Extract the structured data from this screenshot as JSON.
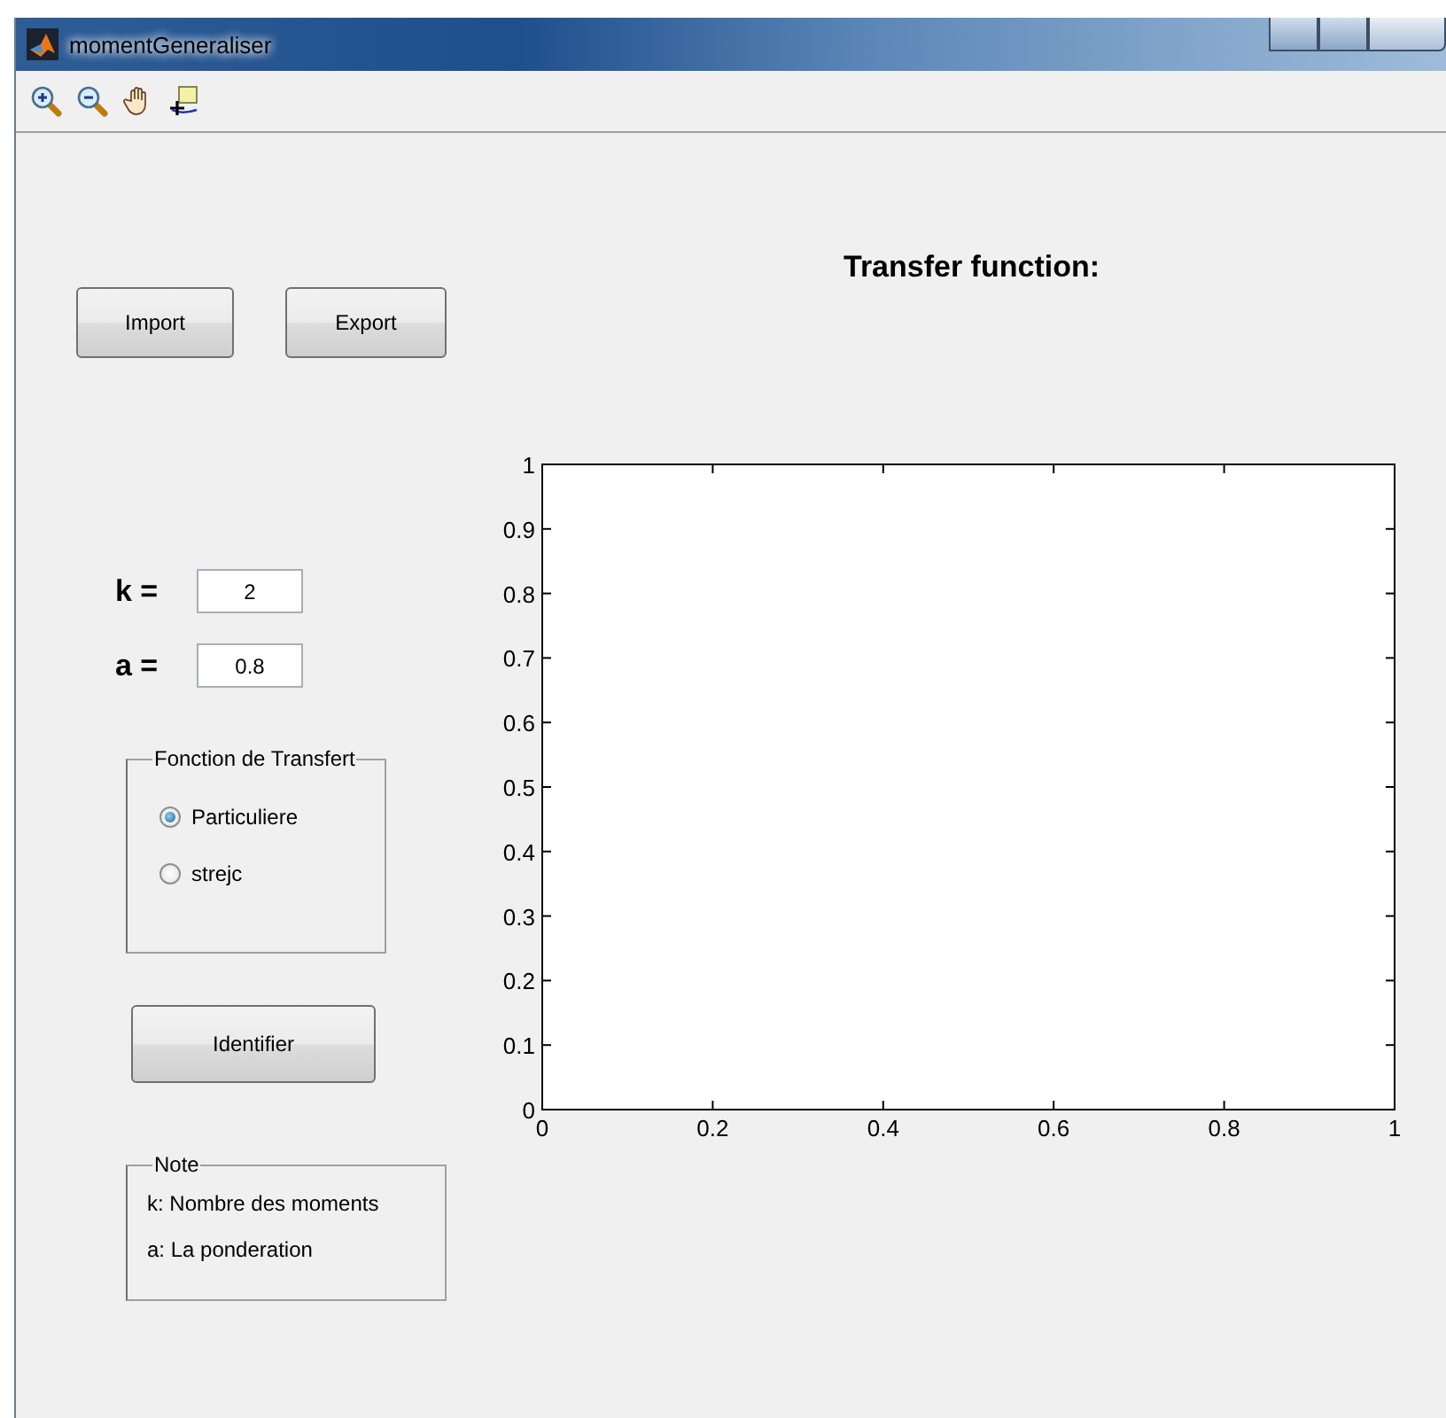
{
  "window": {
    "title": "momentGeneraliser"
  },
  "toolbar": {
    "tools": [
      {
        "kind": "zoom-in"
      },
      {
        "kind": "zoom-out"
      },
      {
        "kind": "pan"
      },
      {
        "kind": "data-cursor"
      }
    ]
  },
  "buttons": [
    {
      "label": "Import"
    },
    {
      "label": "Export"
    }
  ],
  "params": [
    {
      "label": "k =",
      "value": "2"
    },
    {
      "label": "a =",
      "value": "0.8"
    }
  ],
  "transfer_group": {
    "title": "Fonction de Transfert",
    "options": [
      {
        "label": "Particuliere",
        "selected": true
      },
      {
        "label": "strejc",
        "selected": false
      }
    ]
  },
  "identify_button": {
    "label": "Identifier"
  },
  "note": {
    "title": "Note",
    "lines": [
      "k: Nombre des moments",
      "a: La ponderation"
    ]
  },
  "plot": {
    "title": "Transfer function:",
    "chart_data": {
      "type": "line",
      "xlim": [
        0,
        1
      ],
      "ylim": [
        0,
        1
      ],
      "xticks": [
        0,
        0.2,
        0.4,
        0.6,
        0.8,
        1
      ],
      "yticks": [
        0,
        0.1,
        0.2,
        0.3,
        0.4,
        0.5,
        0.6,
        0.7,
        0.8,
        0.9,
        1
      ]
    }
  }
}
